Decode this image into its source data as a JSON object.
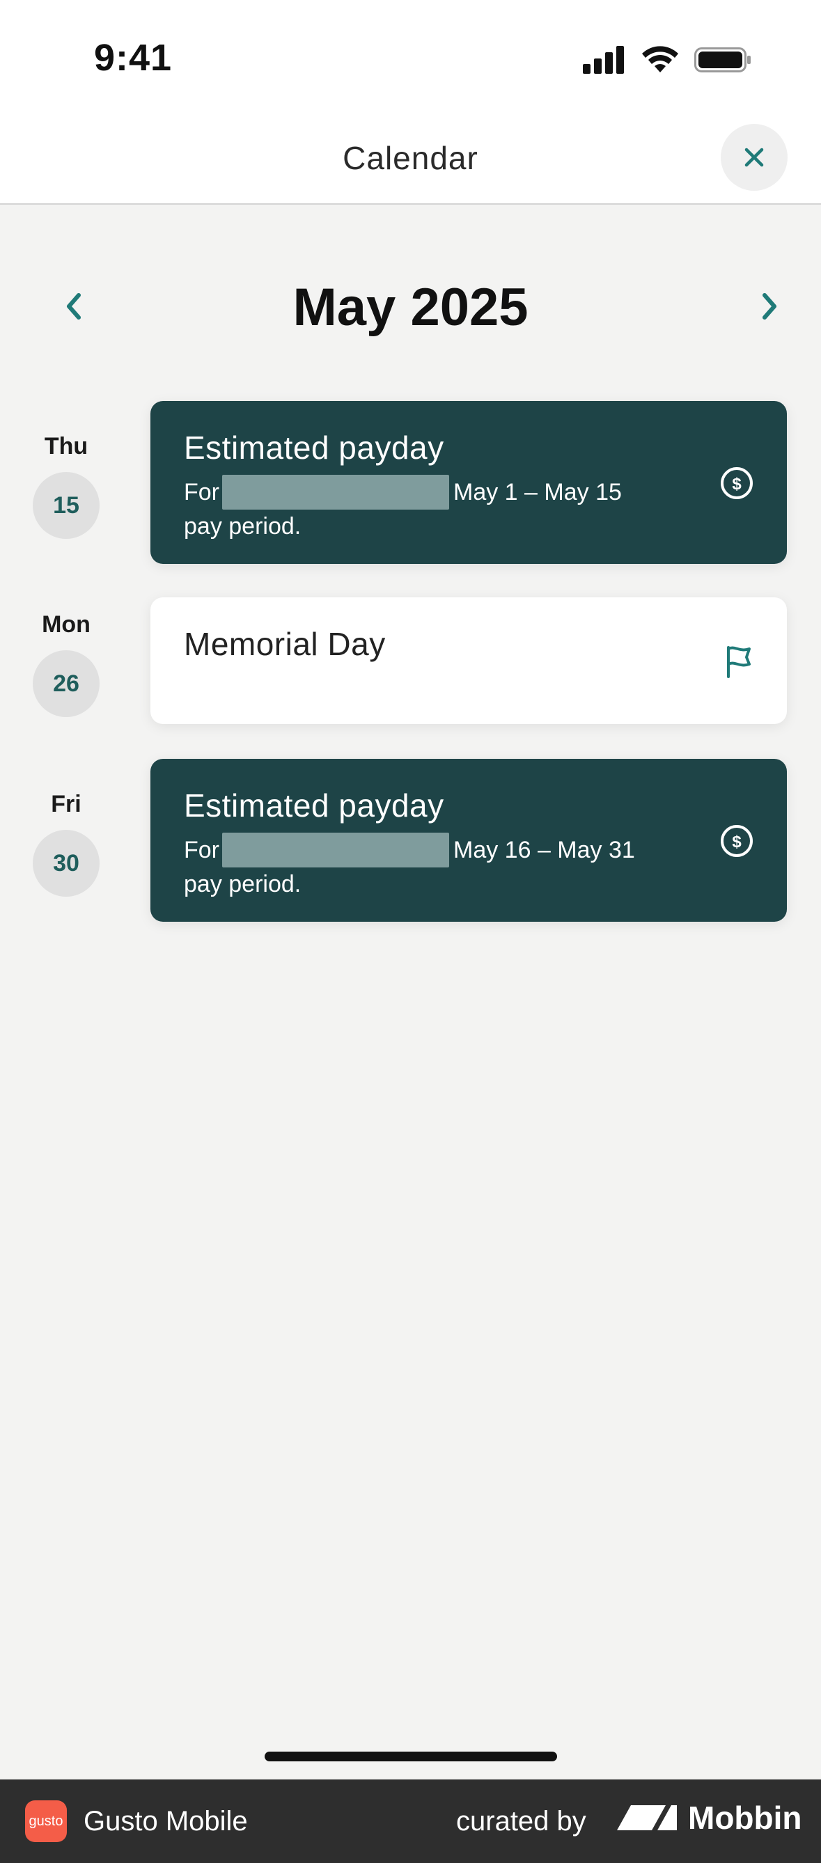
{
  "status_bar": {
    "time": "9:41"
  },
  "header": {
    "title": "Calendar"
  },
  "month": {
    "label": "May 2025"
  },
  "events": [
    {
      "day_name": "Thu",
      "day_number": "15",
      "title": "Estimated payday",
      "desc_prefix": "For",
      "desc_range": "May 1 – May 15",
      "desc_suffix": "pay period.",
      "icon": "dollar-circle-icon"
    },
    {
      "day_name": "Mon",
      "day_number": "26",
      "title": "Memorial Day",
      "icon": "flag-icon"
    },
    {
      "day_name": "Fri",
      "day_number": "30",
      "title": "Estimated payday",
      "desc_prefix": "For",
      "desc_range": "May 16 – May 31",
      "desc_suffix": "pay period.",
      "icon": "dollar-circle-icon"
    }
  ],
  "banner": {
    "logo_text": "gusto",
    "app_name": "Gusto Mobile",
    "curated_by": "curated by",
    "brand": "Mobbin"
  },
  "colors": {
    "accent_teal": "#1f7a78",
    "card_dark": "#1e4447",
    "background": "#f3f3f2"
  }
}
